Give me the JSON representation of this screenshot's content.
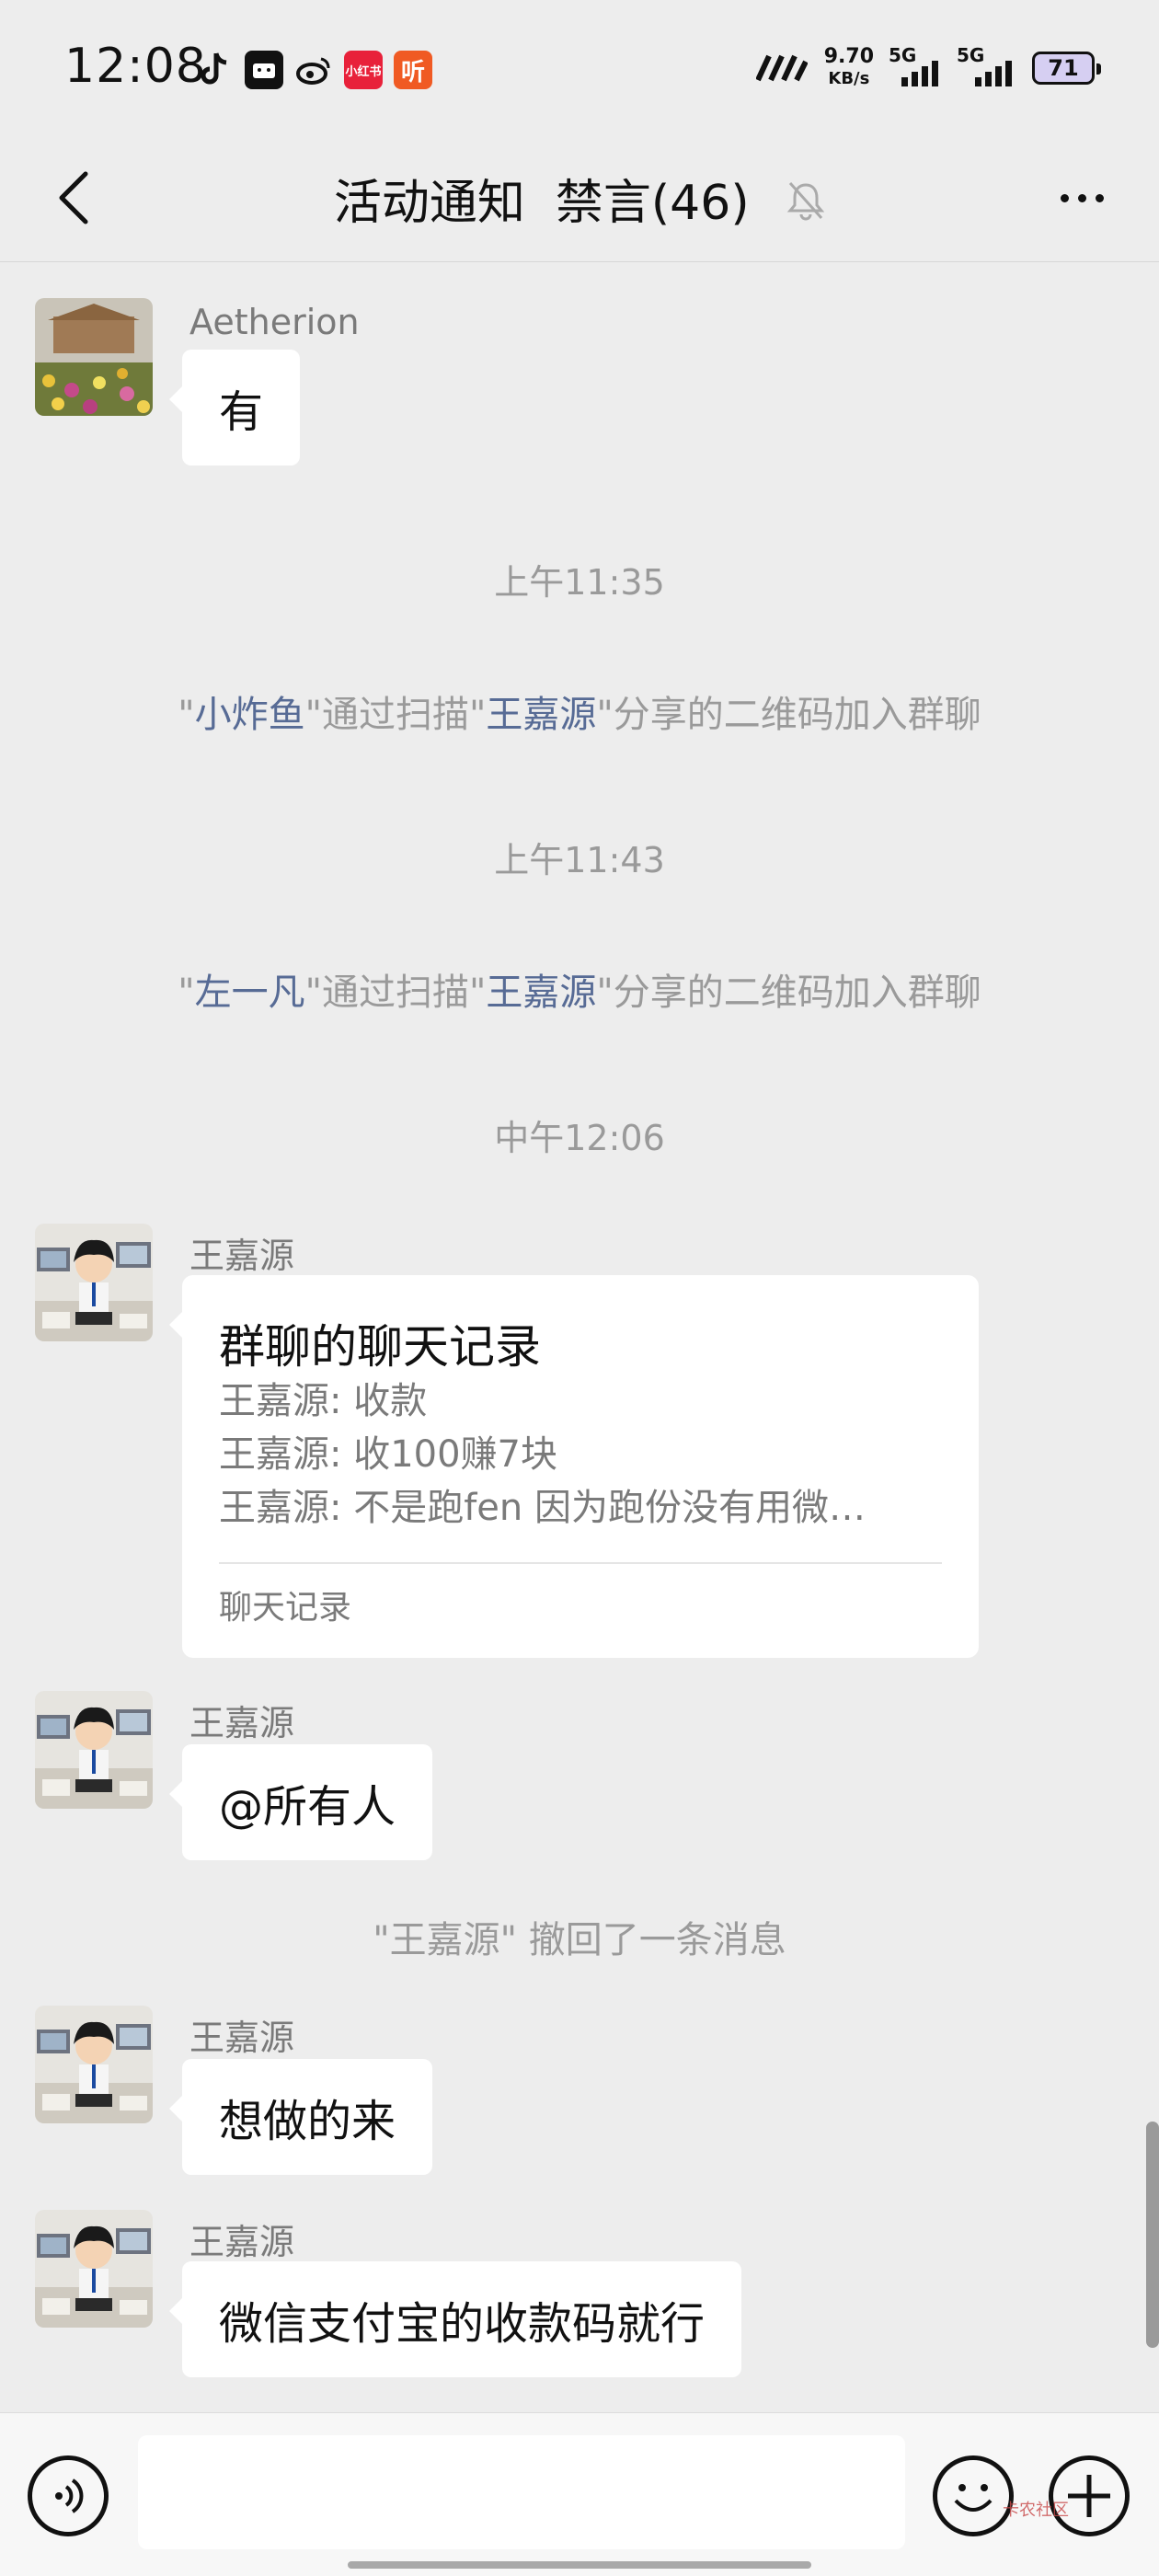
{
  "status_bar": {
    "time": "12:08",
    "net_speed_value": "9.70",
    "net_speed_unit": "KB/s",
    "sim1": "5G",
    "sim2": "5G",
    "battery": "71",
    "app_icons": [
      "tiktok-icon",
      "app-icon",
      "weibo-icon",
      "xiaohongshu-icon",
      "listen-icon"
    ],
    "xhs_label": "小红书",
    "listen_label": "听"
  },
  "header": {
    "title": "活动通知  禁言(46)"
  },
  "messages": {
    "m1": {
      "sender": "Aetherion",
      "text": "有"
    },
    "t1": "上午11:35",
    "s1": {
      "q1": "\"",
      "name1": "小炸鱼",
      "mid": "\"通过扫描\"",
      "name2": "王嘉源",
      "tail": "\"分享的二维码加入群聊"
    },
    "t2": "上午11:43",
    "s2": {
      "q1": "\"",
      "name1": "左一凡",
      "mid": "\"通过扫描\"",
      "name2": "王嘉源",
      "tail": "\"分享的二维码加入群聊"
    },
    "t3": "中午12:06",
    "m2": {
      "sender": "王嘉源",
      "record_title": "群聊的聊天记录",
      "lines": [
        "王嘉源: 收款",
        "王嘉源: 收100赚7块",
        "王嘉源: 不是跑fen  因为跑份没有用微…"
      ],
      "footer": "聊天记录"
    },
    "m3": {
      "sender": "王嘉源",
      "text": "@所有人"
    },
    "recall": "\"王嘉源\" 撤回了一条消息",
    "m4": {
      "sender": "王嘉源",
      "text": "想做的来"
    },
    "m5": {
      "sender": "王嘉源",
      "text": "微信支付宝的收款码就行"
    }
  },
  "input_bar": {
    "watermark": "卡农社区"
  }
}
